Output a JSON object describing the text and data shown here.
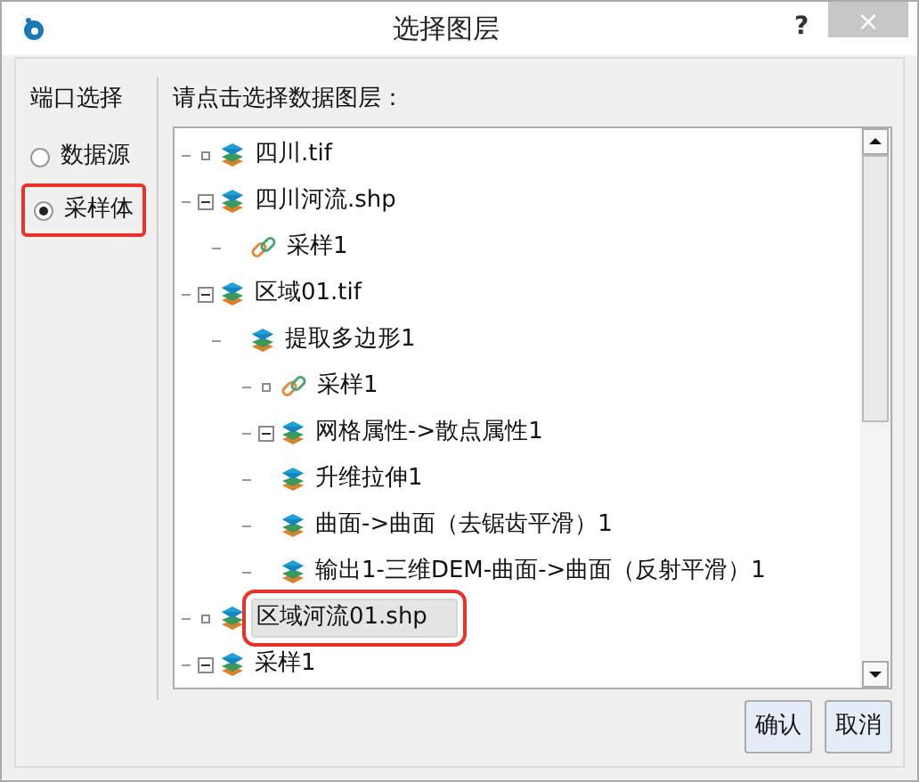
{
  "window": {
    "title": "选择图层",
    "help": "?",
    "close": "×"
  },
  "port_panel": {
    "title": "端口选择",
    "options": [
      {
        "label": "数据源",
        "selected": false,
        "marked": false
      },
      {
        "label": "采样体",
        "selected": true,
        "marked": true
      }
    ]
  },
  "tree": {
    "prompt": "请点击选择数据图层：",
    "items": [
      {
        "label": "四川.tif",
        "kind": "layer",
        "expanded": false,
        "selected": false,
        "marked": false
      },
      {
        "label": "四川河流.shp",
        "kind": "layer",
        "expanded": true,
        "selected": false,
        "marked": false,
        "children": [
          {
            "label": "采样1",
            "kind": "link",
            "selected": false,
            "marked": false
          }
        ]
      },
      {
        "label": "区域01.tif",
        "kind": "layer",
        "expanded": true,
        "selected": false,
        "marked": false,
        "children": [
          {
            "label": "提取多边形1",
            "kind": "layer",
            "selected": false,
            "marked": false,
            "children": [
              {
                "label": "采样1",
                "kind": "link",
                "expanded": false,
                "selected": false,
                "marked": false
              },
              {
                "label": "网格属性->散点属性1",
                "kind": "layer",
                "expanded": true,
                "selected": false,
                "marked": false
              },
              {
                "label": "升维拉伸1",
                "kind": "layer",
                "selected": false,
                "marked": false
              },
              {
                "label": "曲面->曲面（去锯齿平滑）1",
                "kind": "layer",
                "selected": false,
                "marked": false
              },
              {
                "label": "输出1-三维DEM-曲面->曲面（反射平滑）1",
                "kind": "layer",
                "selected": false,
                "marked": false
              }
            ]
          }
        ]
      },
      {
        "label": "区域河流01.shp",
        "kind": "layer",
        "expanded": false,
        "selected": true,
        "marked": true
      },
      {
        "label": "采样1",
        "kind": "layer",
        "expanded": true,
        "selected": false,
        "marked": false
      }
    ]
  },
  "buttons": [
    "确认",
    "取消"
  ]
}
